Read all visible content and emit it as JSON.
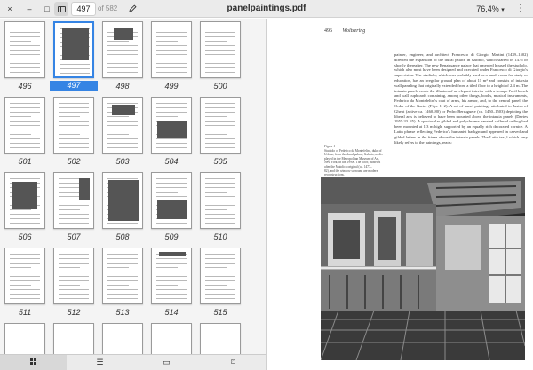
{
  "toolbar": {
    "close_glyph": "×",
    "minimize_glyph": "–",
    "maximize_glyph": "□",
    "page_current": "497",
    "page_total": "of 582",
    "annotate_icon": "pencil-icon",
    "document_title": "panelpaintings.pdf",
    "zoom_level": "76,4%",
    "menu_glyph": "⋮"
  },
  "sidebar": {
    "selected_page": "497",
    "rows": [
      [
        "496",
        "497",
        "498",
        "499",
        "500"
      ],
      [
        "501",
        "502",
        "503",
        "504",
        "505"
      ],
      [
        "506",
        "507",
        "508",
        "509",
        "510"
      ],
      [
        "511",
        "512",
        "513",
        "514",
        "515"
      ]
    ]
  },
  "tabs": [
    {
      "name": "thumbnails",
      "icon": "grid-icon",
      "glyph": ""
    },
    {
      "name": "outline",
      "icon": "outline-icon",
      "glyph": "☰"
    },
    {
      "name": "annotations",
      "icon": "annotations-icon",
      "glyph": "▭"
    },
    {
      "name": "bookmarks",
      "icon": "bookmark-icon",
      "glyph": "⌑"
    }
  ],
  "page": {
    "page_number": "496",
    "section": "Woltsering",
    "body": "painter, engineer, and architect Francesco di Giorgio Martini (1439–1502) directed the expansion of the ducal palace in Gubbio, which started in 1476 or shortly thereafter. The new Renaissance palace that emerged housed the studiolo, which also must have been designed and executed under Francesco di Giorgio's supervision. The studiolo, which was probably used as a small room for study or education, has an irregular ground plan of about 11 m² and consists of intarsia wall paneling that originally extended from a tiled floor to a height of 2.4 m. The intarsia panels create the illusion of an elegant interior with a trompe l'oeil bench and wall cupboards containing, among other things, books, musical instruments, Federico da Montefeltro's coat of arms, his armor, and, to the central panel, the Order of the Garter (Figs. 1, 2). A set of panel paintings attributed to Justus of Ghent (active ca. 1460–80) or Pedro Berruguete (ca. 1450–1503) depicting the liberal arts is believed to have been mounted above the intarsia panels (Davies 1955:33–35). A spectacular gilded and polychrome paneled coffered ceiling had been mounted at 1.3 m high, supported by an equally rich decorated cornice. A Latin phrase reflecting Federico's humanist background appeared in carved and gilded letters in the frieze above the intarsia panels. The Latin text,¹ which very likely refers to the paintings, reads:",
    "caption_lines": [
      "Figure 1",
      "Studiolo of Federico da Montefeltro, duke of",
      "Urbino, from the ducal palace, Gubbio, as dis-",
      "played in the Metropolitan Museum of Art,",
      "New York, in the 1990s. The floor, modeled",
      "after the Maiolica original (ca. 1477–",
      "82), and the window surround are modern",
      "reconstructions."
    ]
  }
}
